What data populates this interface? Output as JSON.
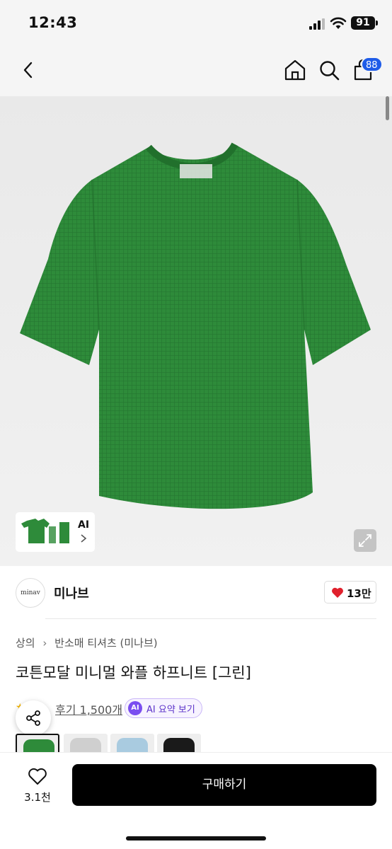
{
  "status_bar": {
    "time": "12:43",
    "battery": "91"
  },
  "nav": {
    "cart_count": "88",
    "icons": [
      "back-icon",
      "home-icon",
      "search-icon",
      "cart-icon"
    ]
  },
  "gallery": {
    "ai_label": "AI",
    "product_color": "#2e8b3a"
  },
  "brand": {
    "logo_text": "minav",
    "name": "미나브",
    "likes": "13만"
  },
  "breadcrumb": {
    "category": "상의",
    "subcategory": "반소매 티셔츠 (미나브)"
  },
  "product": {
    "title": "코튼모달 미니멀 와플 하프니트 [그린]"
  },
  "reviews": {
    "link_text": "후기 1,500개",
    "ai_summary_badge": "AI",
    "ai_summary_label": "AI 요약 보기"
  },
  "swatches": [
    {
      "name": "green",
      "color": "#2e8b3a"
    },
    {
      "name": "light-gray",
      "color": "#cfcfcf"
    },
    {
      "name": "light-blue",
      "color": "#a9cbe0"
    },
    {
      "name": "black",
      "color": "#1a1a1a"
    }
  ],
  "bottom_bar": {
    "wishlist_count": "3.1천",
    "buy_label": "구매하기"
  },
  "colors": {
    "accent_blue": "#1f5ce8",
    "ai_purple": "#7a4df0",
    "heart_red": "#e0202c"
  }
}
